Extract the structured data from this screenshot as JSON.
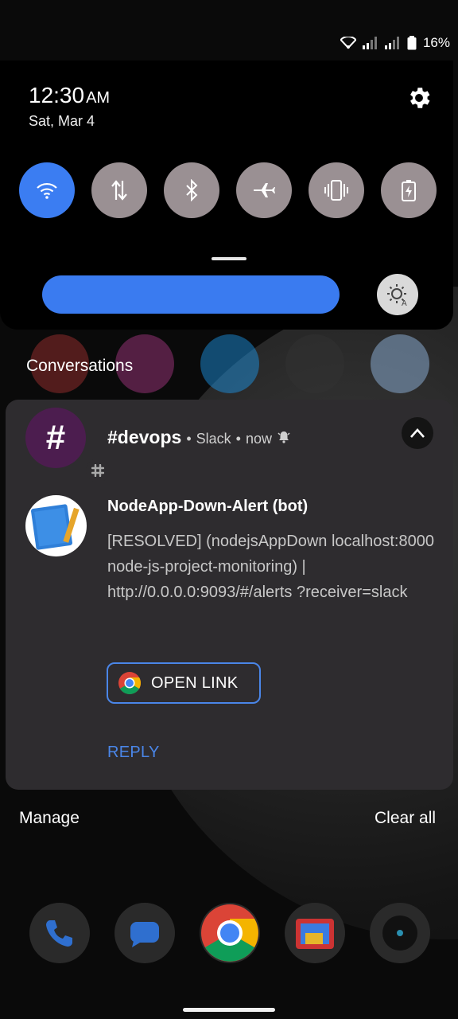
{
  "status_bar": {
    "battery": "16%",
    "icons": [
      "wifi-icon",
      "signal-icon",
      "signal-icon",
      "battery-icon"
    ]
  },
  "quick_settings": {
    "time": "12:30",
    "ampm": "AM",
    "date": "Sat, Mar 4",
    "tiles": [
      {
        "name": "wifi",
        "icon": "wifi-icon",
        "active": true
      },
      {
        "name": "mobile-data",
        "icon": "data-arrows-icon",
        "active": false
      },
      {
        "name": "bluetooth",
        "icon": "bluetooth-icon",
        "active": false
      },
      {
        "name": "airplane",
        "icon": "airplane-icon",
        "active": false
      },
      {
        "name": "vibrate",
        "icon": "vibrate-icon",
        "active": false
      },
      {
        "name": "battery-saver",
        "icon": "battery-saver-icon",
        "active": false
      }
    ]
  },
  "section_title": "Conversations",
  "notification": {
    "channel": "#devops",
    "app": "Slack",
    "time": "now",
    "sender": "NodeApp-Down-Alert (bot)",
    "message": "[RESOLVED]  (nodejsAppDown localhost:8000 node-js-project-monitoring) | http://0.0.0.0:9093/#/alerts ?receiver=slack",
    "open_link_label": "OPEN LINK",
    "reply_label": "REPLY"
  },
  "footer": {
    "manage": "Manage",
    "clear_all": "Clear all"
  },
  "colors": {
    "accent": "#3b7df2",
    "card_bg": "#2e2c2f",
    "tile_inactive": "#9a9093",
    "link_blue": "#4a86e8"
  }
}
